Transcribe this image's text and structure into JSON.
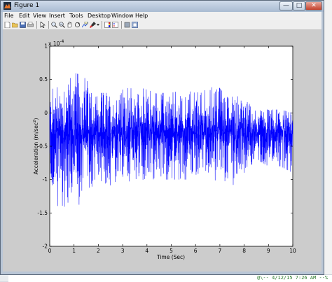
{
  "window": {
    "title": "Figure 1"
  },
  "menu": [
    "File",
    "Edit",
    "View",
    "Insert",
    "Tools",
    "Desktop",
    "Window",
    "Help"
  ],
  "toolbar_icons": [
    "new-figure-icon",
    "open-file-icon",
    "save-icon",
    "print-icon",
    "pointer-icon",
    "zoom-in-icon",
    "zoom-out-icon",
    "pan-icon",
    "rotate-icon",
    "data-cursor-icon",
    "brush-icon",
    "colorbar-icon",
    "legend-icon",
    "hide-plot-tools-icon",
    "show-plot-tools-icon"
  ],
  "background_terminal": {
    "line1": "@\\-- 4/12/15  7:26 AM --%"
  },
  "chart_data": {
    "type": "line",
    "xlabel": "Time (Sec)",
    "ylabel": "Acceleration (m/sec",
    "ylabel_sup": "2",
    "ylabel_end": ")",
    "exponent_base": "x 10",
    "exponent_power": "-4",
    "xlim": [
      0,
      10
    ],
    "ylim": [
      -2,
      1
    ],
    "x_ticks": [
      "0",
      "1",
      "2",
      "3",
      "4",
      "5",
      "6",
      "7",
      "8",
      "9",
      "10"
    ],
    "y_ticks": [
      "-2",
      "-1.5",
      "-1",
      "-0.5",
      "0",
      "0.5",
      "1"
    ],
    "line_color": "#0000ff",
    "grid": false,
    "envelope": {
      "x": [
        0,
        0.5,
        1.0,
        1.5,
        2.0,
        2.5,
        3.0,
        3.5,
        4.0,
        4.5,
        5.0,
        5.5,
        6.0,
        6.5,
        7.0,
        7.5,
        8.0,
        8.5,
        9.0,
        9.5,
        10
      ],
      "upper": [
        0.35,
        0.55,
        0.6,
        0.55,
        0.3,
        0.3,
        0.35,
        0.4,
        0.35,
        0.3,
        0.3,
        0.35,
        0.3,
        0.35,
        0.45,
        0.35,
        0.2,
        0.05,
        0.05,
        0.05,
        0.0
      ],
      "lower": [
        -1.2,
        -1.5,
        -1.5,
        -1.2,
        -1.0,
        -1.1,
        -1.0,
        -1.05,
        -1.0,
        -1.0,
        -1.0,
        -1.0,
        -1.0,
        -0.95,
        -1.05,
        -1.1,
        -0.9,
        -0.7,
        -0.8,
        -0.8,
        -0.9
      ]
    },
    "center": -0.3
  }
}
